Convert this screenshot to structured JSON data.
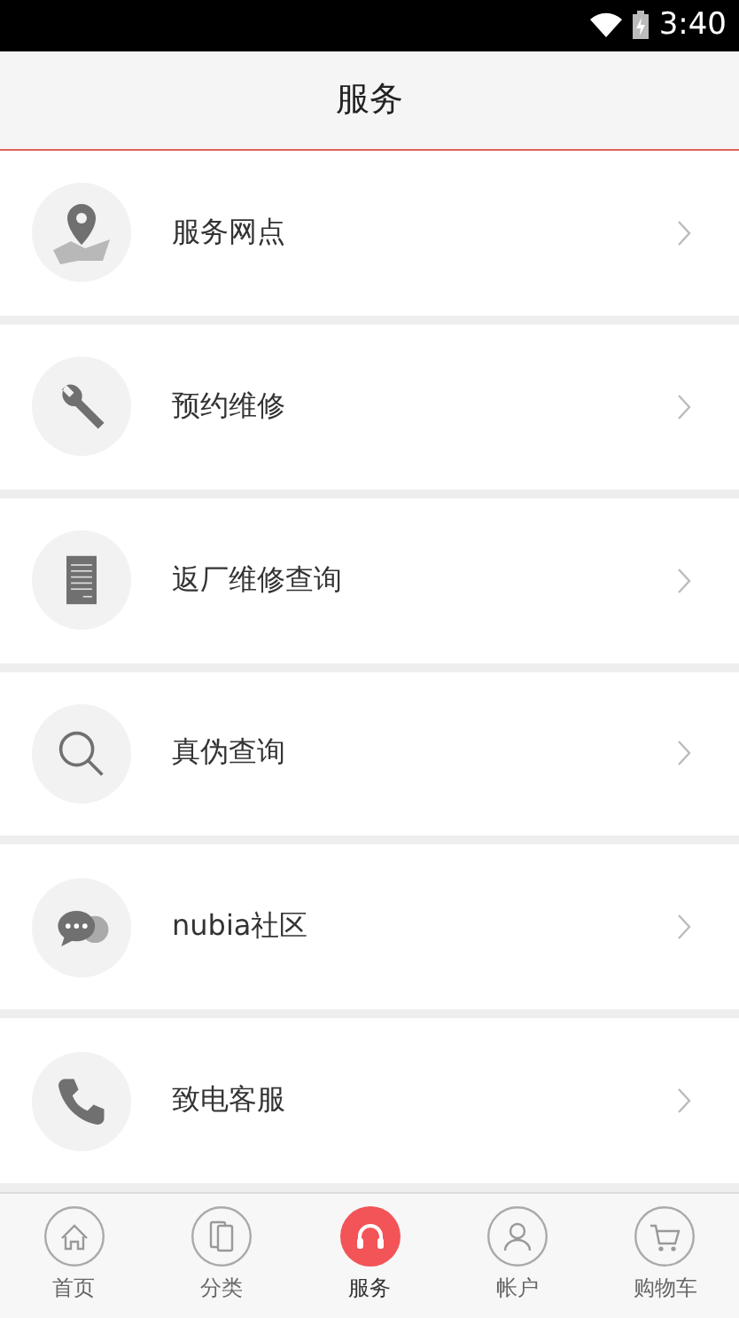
{
  "status_bar": {
    "time": "3:40"
  },
  "header": {
    "title": "服务"
  },
  "items": [
    {
      "label": "服务网点"
    },
    {
      "label": "预约维修"
    },
    {
      "label": "返厂维修查询"
    },
    {
      "label": "真伪查询"
    },
    {
      "label": "nubia社区"
    },
    {
      "label": "致电客服"
    }
  ],
  "tab_bar": [
    {
      "label": "首页",
      "selected": false
    },
    {
      "label": "分类",
      "selected": false
    },
    {
      "label": "服务",
      "selected": true
    },
    {
      "label": "帐户",
      "selected": false
    },
    {
      "label": "购物车",
      "selected": false
    }
  ]
}
